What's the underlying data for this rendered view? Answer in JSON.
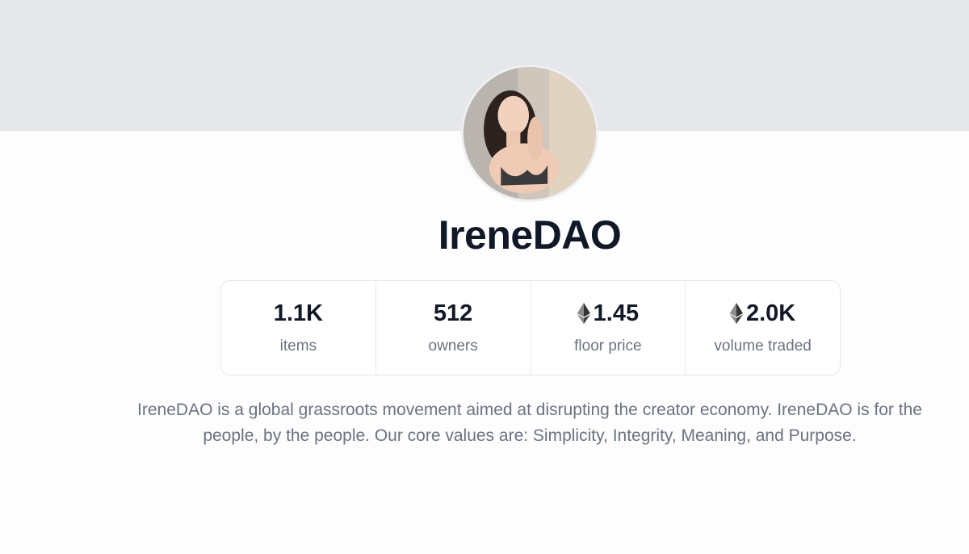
{
  "collection": {
    "name": "IreneDAO",
    "description": "IreneDAO is a global grassroots movement aimed at disrupting the creator economy. IreneDAO is for the people, by the people. Our core values are: Simplicity, Integrity, Meaning, and Purpose."
  },
  "stats": [
    {
      "value": "1.1K",
      "label": "items",
      "icon": ""
    },
    {
      "value": "512",
      "label": "owners",
      "icon": ""
    },
    {
      "value": "1.45",
      "label": "floor price",
      "icon": "ethereum-icon"
    },
    {
      "value": "2.0K",
      "label": "volume traded",
      "icon": "ethereum-icon"
    }
  ],
  "colors": {
    "banner": "#e5e7eb",
    "title": "#111827",
    "muted_text": "#6b7280",
    "border": "#e5e7eb"
  }
}
